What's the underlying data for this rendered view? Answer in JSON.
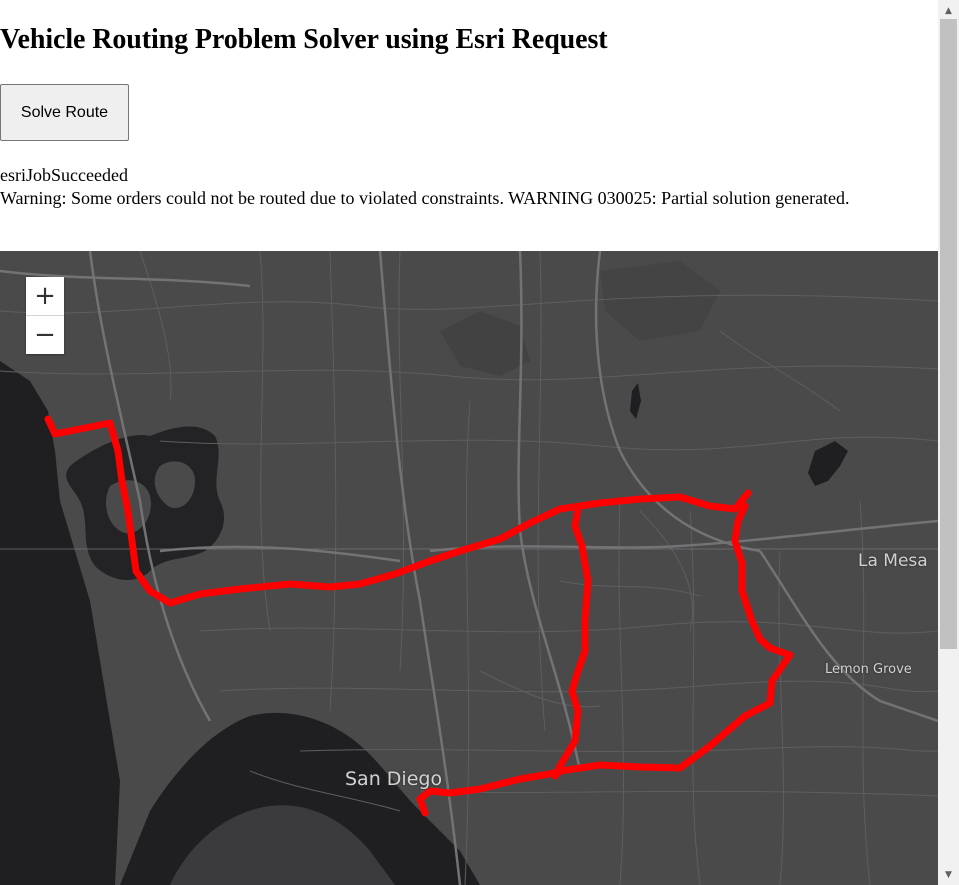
{
  "page": {
    "title": "Vehicle Routing Problem Solver using Esri Request",
    "solve_button_label": "Solve Route",
    "status_text": "esriJobSucceeded",
    "warning_text": "Warning: Some orders could not be routed due to violated constraints. WARNING 030025: Partial solution generated."
  },
  "map": {
    "zoom_in_label": "+",
    "zoom_out_label": "−",
    "place_labels": {
      "san_diego": "San Diego",
      "la_mesa": "La Mesa",
      "lemon_grove": "Lemon Grove"
    },
    "basemap_colors": {
      "land": "#4a4a4b",
      "water": "#1f1f22",
      "roads": "#6e6e70",
      "route": "#ff0000"
    }
  },
  "scrollbar": {
    "up_icon": "scroll-up-arrow-icon",
    "down_icon": "scroll-down-arrow-icon"
  }
}
